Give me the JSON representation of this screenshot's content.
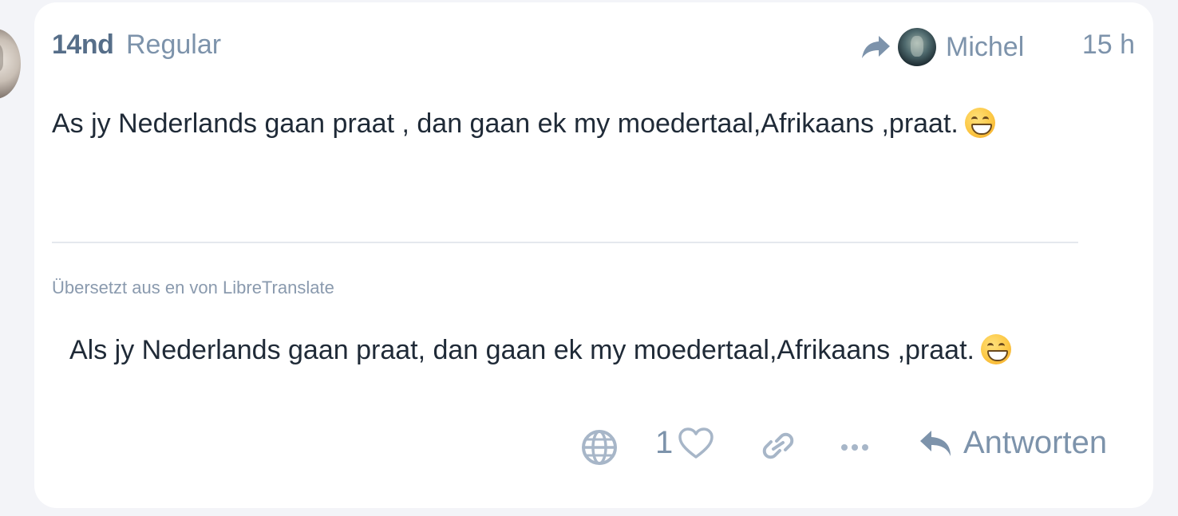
{
  "post": {
    "username": "14nd",
    "user_title": "Regular",
    "reply_to_name": "Michel",
    "timestamp": "15 h",
    "body": "As jy Nederlands gaan praat , dan gaan ek my moedertaal,Afrikaans ,praat.",
    "body_emoji": "grinning-face-emoji",
    "translation_note": "Übersetzt aus en von LibreTranslate",
    "translated_body": "Als jy Nederlands gaan praat, dan gaan ek my moedertaal,Afrikaans ,praat.",
    "translated_emoji": "grinning-face-emoji"
  },
  "actions": {
    "translate_icon": "globe-icon",
    "like_count": "1",
    "like_icon": "heart-icon",
    "link_icon": "link-icon",
    "more_icon": "more-icon",
    "reply_icon": "reply-icon",
    "reply_label": "Antworten"
  },
  "colors": {
    "background": "#f3f4f8",
    "card": "#ffffff",
    "muted": "#7d93ab",
    "username": "#566e89",
    "text": "#1f2a37"
  }
}
